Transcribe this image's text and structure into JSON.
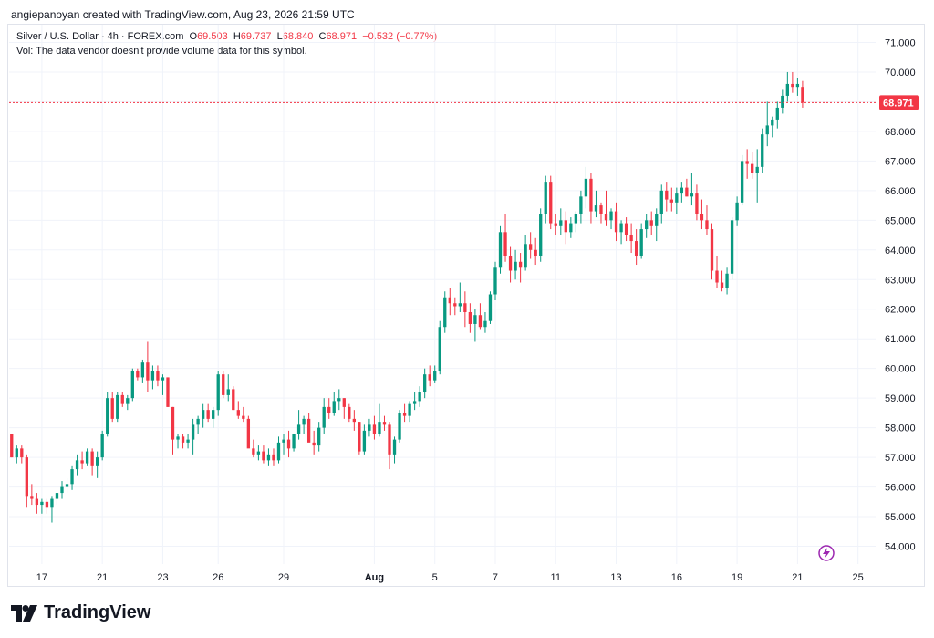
{
  "header": {
    "attribution": "angiepanoyan created with TradingView.com, Aug 23, 2026 21:59 UTC"
  },
  "legend": {
    "symbol": "Silver / U.S. Dollar · 4h · FOREX.com",
    "o_label": "O",
    "o_value": "69.503",
    "h_label": "H",
    "h_value": "69.737",
    "l_label": "L",
    "l_value": "68.840",
    "c_label": "C",
    "c_value": "68.971",
    "change": "−0.532 (−0.77%)",
    "vol_note": "Vol: The data vendor doesn't provide volume data for this symbol."
  },
  "footer": {
    "brand": "TradingView"
  },
  "colors": {
    "up": "#089981",
    "down": "#f23645",
    "grid": "#f0f3fa",
    "last_price": "#f23645"
  },
  "chart_data": {
    "type": "candlestick",
    "ylim": [
      53.4,
      71.6
    ],
    "y_ticks": [
      "54.000",
      "55.000",
      "56.000",
      "57.000",
      "58.000",
      "59.000",
      "60.000",
      "61.000",
      "62.000",
      "63.000",
      "64.000",
      "65.000",
      "66.000",
      "67.000",
      "68.000",
      "69.000",
      "70.000",
      "71.000"
    ],
    "x_ticks": [
      {
        "label": "17",
        "i": 6
      },
      {
        "label": "21",
        "i": 18
      },
      {
        "label": "23",
        "i": 30
      },
      {
        "label": "26",
        "i": 41
      },
      {
        "label": "29",
        "i": 54
      },
      {
        "label": "Aug",
        "i": 72
      },
      {
        "label": "5",
        "i": 84
      },
      {
        "label": "7",
        "i": 96
      },
      {
        "label": "11",
        "i": 108
      },
      {
        "label": "13",
        "i": 120
      },
      {
        "label": "16",
        "i": 132
      },
      {
        "label": "19",
        "i": 144
      },
      {
        "label": "21",
        "i": 156
      },
      {
        "label": "25",
        "i": 168
      }
    ],
    "last_price": 68.971,
    "last_price_label": "68.971",
    "candles": [
      [
        57.8,
        57.8,
        57.0,
        57.0
      ],
      [
        57.0,
        57.4,
        56.8,
        57.3
      ],
      [
        57.3,
        57.4,
        56.8,
        57.0
      ],
      [
        57.0,
        57.1,
        55.3,
        55.7
      ],
      [
        55.7,
        56.1,
        55.4,
        55.6
      ],
      [
        55.6,
        55.8,
        55.1,
        55.4
      ],
      [
        55.4,
        55.6,
        55.1,
        55.5
      ],
      [
        55.5,
        55.6,
        55.1,
        55.3
      ],
      [
        55.3,
        55.7,
        54.8,
        55.6
      ],
      [
        55.6,
        55.8,
        55.4,
        55.8
      ],
      [
        55.8,
        56.2,
        55.6,
        56.0
      ],
      [
        56.0,
        56.3,
        55.8,
        56.1
      ],
      [
        56.1,
        56.7,
        55.9,
        56.6
      ],
      [
        56.6,
        57.1,
        56.4,
        56.9
      ],
      [
        56.9,
        57.2,
        56.6,
        56.8
      ],
      [
        56.8,
        57.3,
        56.7,
        57.2
      ],
      [
        57.2,
        57.3,
        56.4,
        56.7
      ],
      [
        56.7,
        57.2,
        56.3,
        57.0
      ],
      [
        57.0,
        57.9,
        56.9,
        57.8
      ],
      [
        57.8,
        59.2,
        57.7,
        59.0
      ],
      [
        59.0,
        59.2,
        58.2,
        58.3
      ],
      [
        58.3,
        59.2,
        58.2,
        59.1
      ],
      [
        59.1,
        59.2,
        58.7,
        58.8
      ],
      [
        58.8,
        59.1,
        58.6,
        59.0
      ],
      [
        59.0,
        60.0,
        58.9,
        59.9
      ],
      [
        59.9,
        60.0,
        59.6,
        59.7
      ],
      [
        59.7,
        60.3,
        59.5,
        60.2
      ],
      [
        60.2,
        60.9,
        59.2,
        59.6
      ],
      [
        59.6,
        60.1,
        59.3,
        59.9
      ],
      [
        59.9,
        60.1,
        59.4,
        59.6
      ],
      [
        59.6,
        59.8,
        59.1,
        59.7
      ],
      [
        59.7,
        59.7,
        58.7,
        58.7
      ],
      [
        58.7,
        58.7,
        57.1,
        57.6
      ],
      [
        57.6,
        57.8,
        57.3,
        57.7
      ],
      [
        57.7,
        57.8,
        57.3,
        57.5
      ],
      [
        57.5,
        57.8,
        57.3,
        57.6
      ],
      [
        57.6,
        58.3,
        57.1,
        58.1
      ],
      [
        58.1,
        58.4,
        57.8,
        58.3
      ],
      [
        58.3,
        58.8,
        58.0,
        58.6
      ],
      [
        58.6,
        58.8,
        58.2,
        58.3
      ],
      [
        58.3,
        58.7,
        58.0,
        58.6
      ],
      [
        58.6,
        59.9,
        58.4,
        59.8
      ],
      [
        59.8,
        59.9,
        59.0,
        59.1
      ],
      [
        59.1,
        59.8,
        58.9,
        59.3
      ],
      [
        59.3,
        59.4,
        58.6,
        58.6
      ],
      [
        58.6,
        58.9,
        58.3,
        58.4
      ],
      [
        58.4,
        58.7,
        58.2,
        58.3
      ],
      [
        58.3,
        58.4,
        57.5,
        57.3
      ],
      [
        57.3,
        57.6,
        57.0,
        57.1
      ],
      [
        57.1,
        57.4,
        56.9,
        57.2
      ],
      [
        57.2,
        57.4,
        56.8,
        56.9
      ],
      [
        56.9,
        57.3,
        56.7,
        57.1
      ],
      [
        57.1,
        57.3,
        56.7,
        56.9
      ],
      [
        56.9,
        57.7,
        56.8,
        57.5
      ],
      [
        57.5,
        57.8,
        57.1,
        57.6
      ],
      [
        57.6,
        57.9,
        57.0,
        57.3
      ],
      [
        57.3,
        57.8,
        57.2,
        57.8
      ],
      [
        57.8,
        58.6,
        57.6,
        58.1
      ],
      [
        58.1,
        58.4,
        57.8,
        58.3
      ],
      [
        58.3,
        58.5,
        57.6,
        57.5
      ],
      [
        57.5,
        57.9,
        57.1,
        57.4
      ],
      [
        57.4,
        58.2,
        57.2,
        58.0
      ],
      [
        58.0,
        59.0,
        57.8,
        58.7
      ],
      [
        58.7,
        59.0,
        58.3,
        58.5
      ],
      [
        58.5,
        59.2,
        58.4,
        58.9
      ],
      [
        58.9,
        59.3,
        58.6,
        59.0
      ],
      [
        59.0,
        59.0,
        58.3,
        58.7
      ],
      [
        58.7,
        58.8,
        58.2,
        58.3
      ],
      [
        58.3,
        58.6,
        57.9,
        58.2
      ],
      [
        58.2,
        58.2,
        57.1,
        57.2
      ],
      [
        57.2,
        58.1,
        57.1,
        57.9
      ],
      [
        57.9,
        58.3,
        57.7,
        58.1
      ],
      [
        58.1,
        58.4,
        57.6,
        57.8
      ],
      [
        57.8,
        58.8,
        57.7,
        58.2
      ],
      [
        58.2,
        58.4,
        57.9,
        58.1
      ],
      [
        58.1,
        58.2,
        56.6,
        57.1
      ],
      [
        57.1,
        57.7,
        56.8,
        57.6
      ],
      [
        57.6,
        58.6,
        57.5,
        58.5
      ],
      [
        58.5,
        58.8,
        58.2,
        58.4
      ],
      [
        58.4,
        58.9,
        58.2,
        58.8
      ],
      [
        58.8,
        59.2,
        58.6,
        58.9
      ],
      [
        58.9,
        59.4,
        58.7,
        59.2
      ],
      [
        59.2,
        60.0,
        59.0,
        59.8
      ],
      [
        59.8,
        60.1,
        59.4,
        59.6
      ],
      [
        59.6,
        60.1,
        59.5,
        59.9
      ],
      [
        59.9,
        61.6,
        59.8,
        61.4
      ],
      [
        61.4,
        62.6,
        61.2,
        62.4
      ],
      [
        62.4,
        62.7,
        61.8,
        62.2
      ],
      [
        62.2,
        62.4,
        61.8,
        62.1
      ],
      [
        62.1,
        62.9,
        61.9,
        62.2
      ],
      [
        62.2,
        62.6,
        61.4,
        61.9
      ],
      [
        61.9,
        62.2,
        61.2,
        61.5
      ],
      [
        61.5,
        62.0,
        60.9,
        61.8
      ],
      [
        61.8,
        62.2,
        61.3,
        61.4
      ],
      [
        61.4,
        61.9,
        61.2,
        61.6
      ],
      [
        61.6,
        62.6,
        61.5,
        62.5
      ],
      [
        62.5,
        63.6,
        62.3,
        63.4
      ],
      [
        63.4,
        64.8,
        63.2,
        64.6
      ],
      [
        64.6,
        65.2,
        63.6,
        63.8
      ],
      [
        63.8,
        64.1,
        62.9,
        63.3
      ],
      [
        63.3,
        64.0,
        63.0,
        63.6
      ],
      [
        63.6,
        63.9,
        62.9,
        63.4
      ],
      [
        63.4,
        64.5,
        63.3,
        64.2
      ],
      [
        64.2,
        64.6,
        63.7,
        64.0
      ],
      [
        64.0,
        64.4,
        63.5,
        63.8
      ],
      [
        63.8,
        65.4,
        63.6,
        65.2
      ],
      [
        65.2,
        66.5,
        64.9,
        66.3
      ],
      [
        66.3,
        66.5,
        64.7,
        64.9
      ],
      [
        64.9,
        65.2,
        64.5,
        64.8
      ],
      [
        64.8,
        65.4,
        64.5,
        65.0
      ],
      [
        65.0,
        65.3,
        64.2,
        64.6
      ],
      [
        64.6,
        65.1,
        64.4,
        64.9
      ],
      [
        64.9,
        65.3,
        64.6,
        65.2
      ],
      [
        65.2,
        66.0,
        64.9,
        65.8
      ],
      [
        65.8,
        66.8,
        65.4,
        66.4
      ],
      [
        66.4,
        66.6,
        64.9,
        65.3
      ],
      [
        65.3,
        66.0,
        65.1,
        65.5
      ],
      [
        65.5,
        65.6,
        64.9,
        65.2
      ],
      [
        65.2,
        66.0,
        64.8,
        65.0
      ],
      [
        65.0,
        65.4,
        64.7,
        65.3
      ],
      [
        65.3,
        65.6,
        64.3,
        64.6
      ],
      [
        64.6,
        65.0,
        64.2,
        64.9
      ],
      [
        64.9,
        65.1,
        64.3,
        64.5
      ],
      [
        64.5,
        64.9,
        63.9,
        64.3
      ],
      [
        64.3,
        64.7,
        63.5,
        63.8
      ],
      [
        63.8,
        64.9,
        63.7,
        64.7
      ],
      [
        64.7,
        65.2,
        64.4,
        65.0
      ],
      [
        65.0,
        65.3,
        64.5,
        64.8
      ],
      [
        64.8,
        65.4,
        64.3,
        65.2
      ],
      [
        65.2,
        66.2,
        64.9,
        66.0
      ],
      [
        66.0,
        66.3,
        65.3,
        65.7
      ],
      [
        65.7,
        66.1,
        65.3,
        65.6
      ],
      [
        65.6,
        66.1,
        65.2,
        65.9
      ],
      [
        65.9,
        66.3,
        65.6,
        66.1
      ],
      [
        66.1,
        66.4,
        65.8,
        65.8
      ],
      [
        65.8,
        66.6,
        65.5,
        65.9
      ],
      [
        65.9,
        66.2,
        65.0,
        65.2
      ],
      [
        65.2,
        65.7,
        64.7,
        65.0
      ],
      [
        65.0,
        65.5,
        64.5,
        64.7
      ],
      [
        64.7,
        64.9,
        63.0,
        63.3
      ],
      [
        63.3,
        63.8,
        62.7,
        62.9
      ],
      [
        62.9,
        63.3,
        62.6,
        62.7
      ],
      [
        62.7,
        63.4,
        62.5,
        63.2
      ],
      [
        63.2,
        65.1,
        63.0,
        65.0
      ],
      [
        65.0,
        65.8,
        64.8,
        65.6
      ],
      [
        65.6,
        67.2,
        65.5,
        67.0
      ],
      [
        67.0,
        67.4,
        66.4,
        66.9
      ],
      [
        66.9,
        67.3,
        66.4,
        66.6
      ],
      [
        66.6,
        67.4,
        65.6,
        66.8
      ],
      [
        66.8,
        68.1,
        66.6,
        67.9
      ],
      [
        67.9,
        69.0,
        67.5,
        68.2
      ],
      [
        68.2,
        68.5,
        67.8,
        68.4
      ],
      [
        68.4,
        69.0,
        68.1,
        68.8
      ],
      [
        68.8,
        69.4,
        68.6,
        69.2
      ],
      [
        69.2,
        70.0,
        69.0,
        69.6
      ],
      [
        69.6,
        70.0,
        69.3,
        69.5
      ],
      [
        69.5,
        69.8,
        69.2,
        69.6
      ],
      [
        69.5,
        69.7,
        68.8,
        68.971
      ]
    ]
  }
}
